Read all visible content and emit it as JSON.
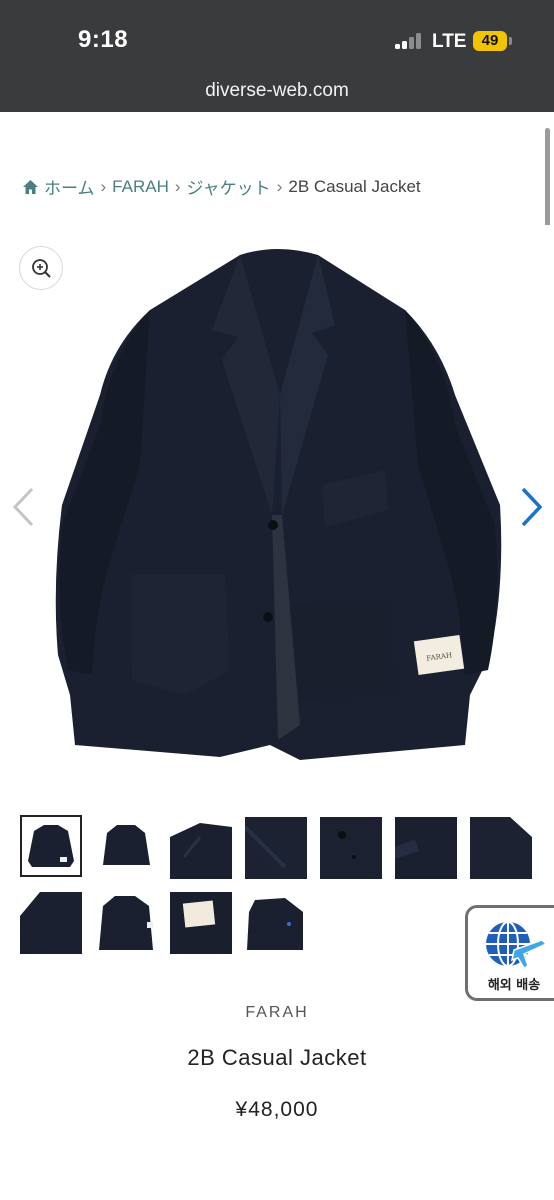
{
  "status_bar": {
    "time": "9:18",
    "network": "LTE",
    "battery": "49"
  },
  "browser": {
    "url": "diverse-web.com"
  },
  "breadcrumb": {
    "items": [
      "ホーム",
      "FARAH",
      "ジャケット"
    ],
    "separator": "›",
    "current": "2B Casual Jacket"
  },
  "gallery": {
    "main_image": "navy-2b-casual-jacket",
    "tag_text": "FARAH",
    "thumbnail_count": 11,
    "active_index": 0
  },
  "shipping_badge": {
    "label": "해외 배송",
    "icon": "globe-plane-icon"
  },
  "product": {
    "brand": "FARAH",
    "name": "2B Casual Jacket",
    "price": "¥48,000"
  },
  "colors": {
    "accent": "#4a7f82",
    "jacket": "#1b2030",
    "topbar": "#393b3d",
    "arrow": "#1a73c8"
  }
}
